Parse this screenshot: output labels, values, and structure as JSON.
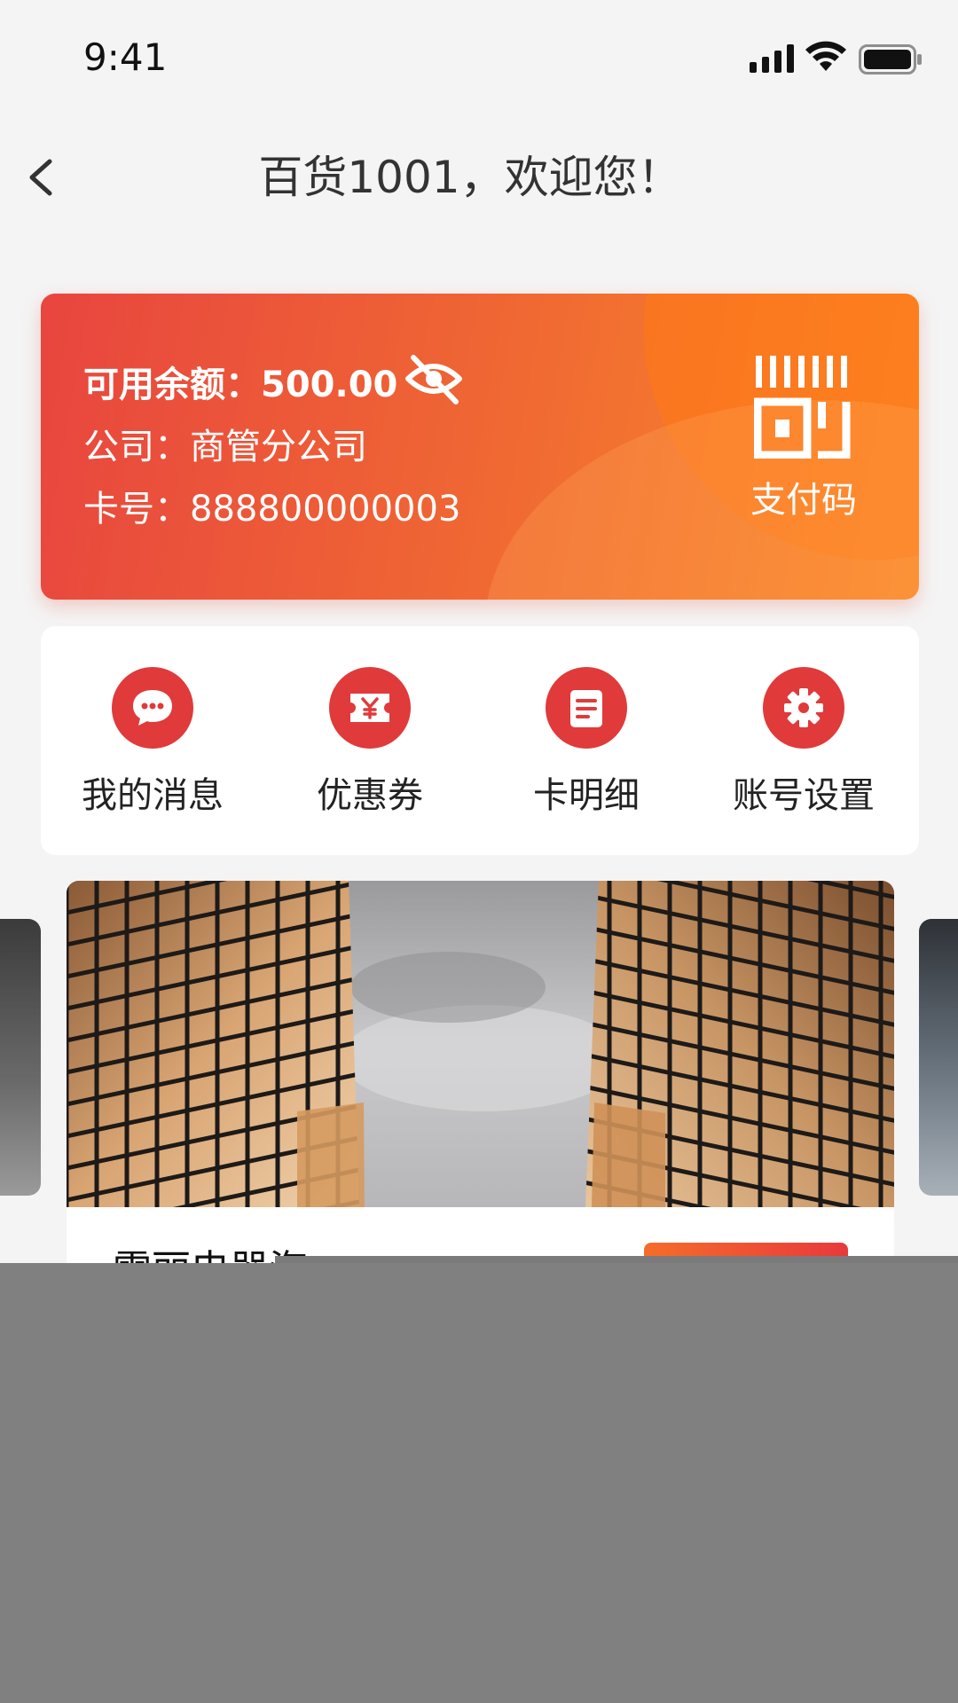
{
  "status_bar": {
    "time": "9:41"
  },
  "nav": {
    "title": "百货1001，欢迎您！"
  },
  "card": {
    "balance_label": "可用余额：500.00",
    "company_label": "公司：商管分公司",
    "card_no_label": "卡号：888800000003",
    "paycode_label": "支付码"
  },
  "actions": [
    {
      "label": "我的消息",
      "icon": "message-icon"
    },
    {
      "label": "优惠券",
      "icon": "coupon-icon"
    },
    {
      "label": "卡明细",
      "icon": "card-detail-icon"
    },
    {
      "label": "账号设置",
      "icon": "settings-icon"
    }
  ],
  "promo": {
    "title": "雷丽电器海"
  },
  "colors": {
    "accent_red": "#e03a3a",
    "card_orange": "#fb8a2a",
    "overlay": "#808080"
  }
}
